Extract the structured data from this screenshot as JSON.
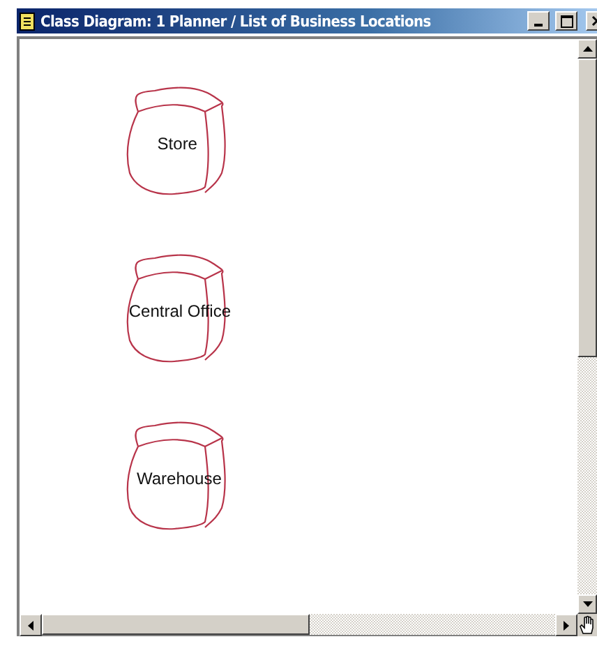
{
  "window": {
    "title": "Class Diagram: 1 Planner / List of Business Locations"
  },
  "diagram": {
    "nodes": [
      {
        "label": "Store"
      },
      {
        "label": "Central Office"
      },
      {
        "label": "Warehouse"
      }
    ]
  }
}
